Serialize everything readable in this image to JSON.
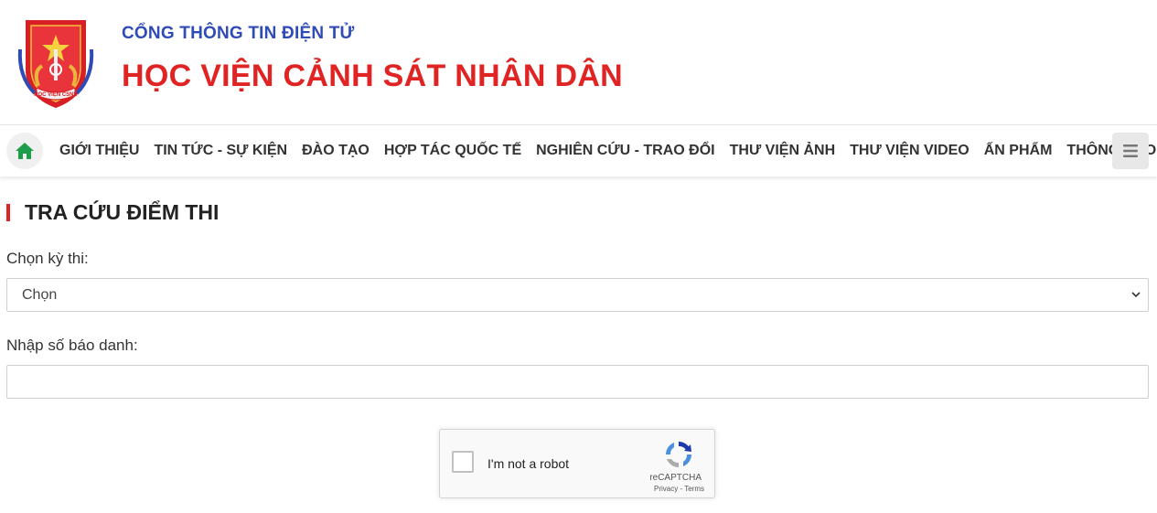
{
  "header": {
    "portal_title": "CỔNG THÔNG TIN ĐIỆN TỬ",
    "site_title": "HỌC VIỆN CẢNH SÁT NHÂN DÂN",
    "logo_text": "HỌC VIỆN CSND",
    "logo_icon": "police-academy-emblem"
  },
  "nav": {
    "home_icon": "home-icon",
    "items": [
      {
        "label": "GIỚI THIỆU"
      },
      {
        "label": "TIN TỨC - SỰ KIỆN"
      },
      {
        "label": "ĐÀO TẠO"
      },
      {
        "label": "HỢP TÁC QUỐC TẾ"
      },
      {
        "label": "NGHIÊN CỨU - TRAO ĐỔI"
      },
      {
        "label": "THƯ VIỆN ẢNH"
      },
      {
        "label": "THƯ VIỆN VIDEO"
      },
      {
        "label": "ẤN PHẨM"
      },
      {
        "label": "THÔNG BÁO"
      }
    ],
    "menu_icon": "hamburger-icon"
  },
  "main": {
    "section_title": "TRA CỨU ĐIỂM THI",
    "exam_label": "Chọn kỳ thi:",
    "exam_select_value": "Chọn",
    "candidate_label": "Nhập số báo danh:",
    "candidate_value": ""
  },
  "captcha": {
    "label": "I'm not a robot",
    "brand": "reCAPTCHA",
    "privacy": "Privacy",
    "separator": " - ",
    "terms": "Terms"
  },
  "colors": {
    "accent_red": "#e02424",
    "portal_blue": "#2f4bb5",
    "home_green": "#1e9e4a"
  }
}
